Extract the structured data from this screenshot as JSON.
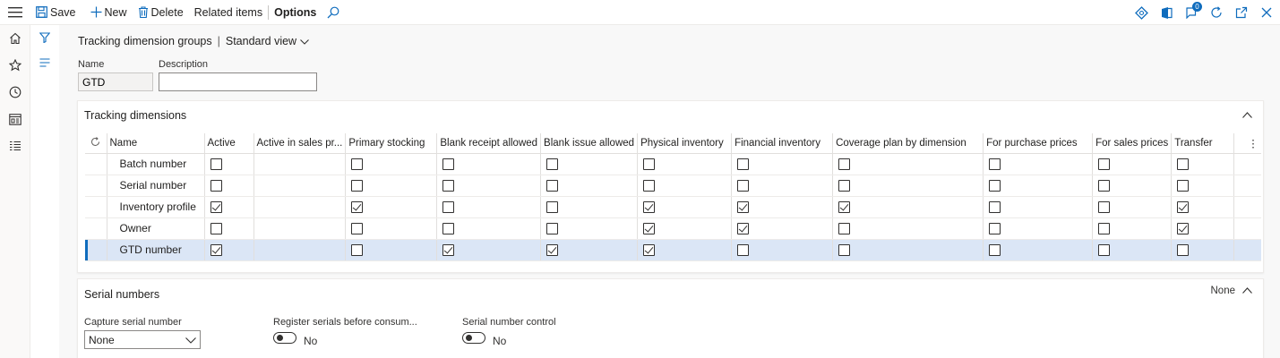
{
  "toolbar": {
    "save_label": "Save",
    "new_label": "New",
    "delete_label": "Delete",
    "related_label": "Related items",
    "options_label": "Options",
    "notification_count": "0"
  },
  "breadcrumb": {
    "page": "Tracking dimension groups",
    "separator": "|",
    "view": "Standard view"
  },
  "form": {
    "name_label": "Name",
    "name_value": "GTD",
    "description_label": "Description",
    "description_value": ""
  },
  "tracking": {
    "title": "Tracking dimensions",
    "columns": [
      "Name",
      "Active",
      "Active in sales pr...",
      "Primary stocking",
      "Blank receipt allowed",
      "Blank issue allowed",
      "Physical inventory",
      "Financial inventory",
      "Coverage plan by dimension",
      "For purchase prices",
      "For sales prices",
      "Transfer"
    ],
    "rows": [
      {
        "name": "Batch number",
        "checks": [
          false,
          null,
          false,
          false,
          false,
          false,
          false,
          false,
          false,
          false,
          false
        ]
      },
      {
        "name": "Serial number",
        "checks": [
          false,
          null,
          false,
          false,
          false,
          false,
          false,
          false,
          false,
          false,
          false
        ]
      },
      {
        "name": "Inventory profile",
        "checks": [
          true,
          null,
          true,
          false,
          false,
          true,
          true,
          true,
          false,
          false,
          true
        ]
      },
      {
        "name": "Owner",
        "checks": [
          false,
          null,
          false,
          false,
          false,
          true,
          true,
          false,
          false,
          false,
          true
        ]
      },
      {
        "name": "GTD number",
        "checks": [
          true,
          null,
          false,
          true,
          true,
          true,
          false,
          false,
          false,
          false,
          false
        ]
      }
    ],
    "selected_row": 4
  },
  "serial": {
    "title": "Serial numbers",
    "summary": "None",
    "capture_label": "Capture serial number",
    "capture_value": "None",
    "register_label": "Register serials before consum...",
    "register_value": "No",
    "control_label": "Serial number control",
    "control_value": "No"
  }
}
